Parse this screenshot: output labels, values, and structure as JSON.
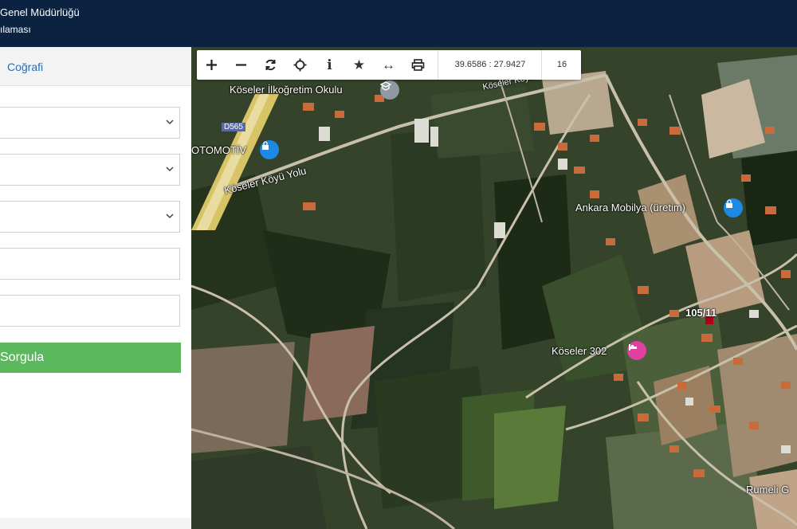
{
  "header": {
    "line1": "Genel Müdürlüğü",
    "line2": "ılaması"
  },
  "sidebar": {
    "tab_label": "Coğrafi",
    "query_button": "Sorgula"
  },
  "toolbar": {
    "zoom_in": "+",
    "zoom_out": "−",
    "info": "i",
    "star": "★",
    "measure": "↔",
    "coordinates": "39.6586 : 27.9427",
    "zoom_level": "16"
  },
  "map": {
    "labels": {
      "school": "Köseler İlkoğretim Okulu",
      "road_d565": "D565",
      "otomotiv": "OTOMOTİV",
      "koy_yolu": "Köseler Köyü Yolu",
      "road_top": "Köseler Köyü",
      "mobilya": "Ankara Mobilya (üretim)",
      "parcel": "105/11",
      "koseler302": "Köseler 302",
      "rumeli": "Rumeli G"
    }
  },
  "colors": {
    "header_bg": "#0b2340",
    "sorgula_green": "#5cb85c",
    "pin_blue": "#1e88e5",
    "pin_pink": "#e040a0"
  }
}
